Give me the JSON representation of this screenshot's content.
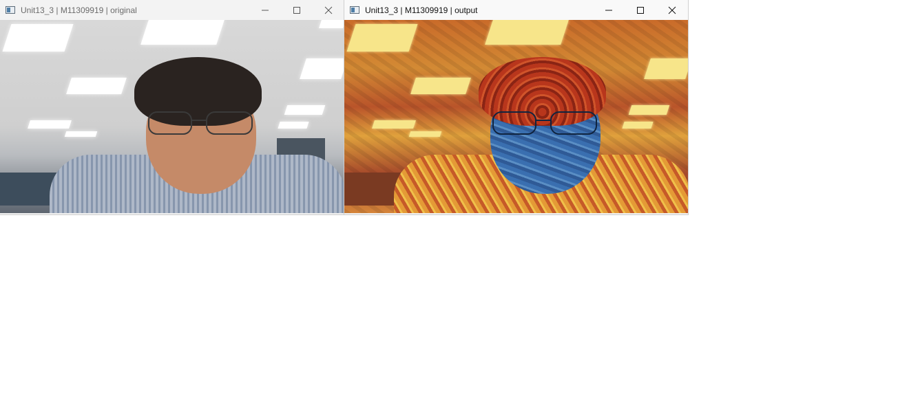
{
  "windows": [
    {
      "id": "original",
      "title": "Unit13_3 | M11309919 | original",
      "icon": "app-window-icon",
      "controls": [
        "minimize-icon",
        "maximize-icon",
        "close-icon"
      ]
    },
    {
      "id": "output",
      "title": "Unit13_3 | M11309919 | output",
      "icon": "app-window-icon",
      "controls": [
        "minimize-icon",
        "maximize-icon",
        "close-icon"
      ]
    }
  ],
  "colors": {
    "titlebar_inactive_text": "#6b6b6b",
    "titlebar_active_text": "#111111",
    "desktop_background": "#ffffff"
  }
}
